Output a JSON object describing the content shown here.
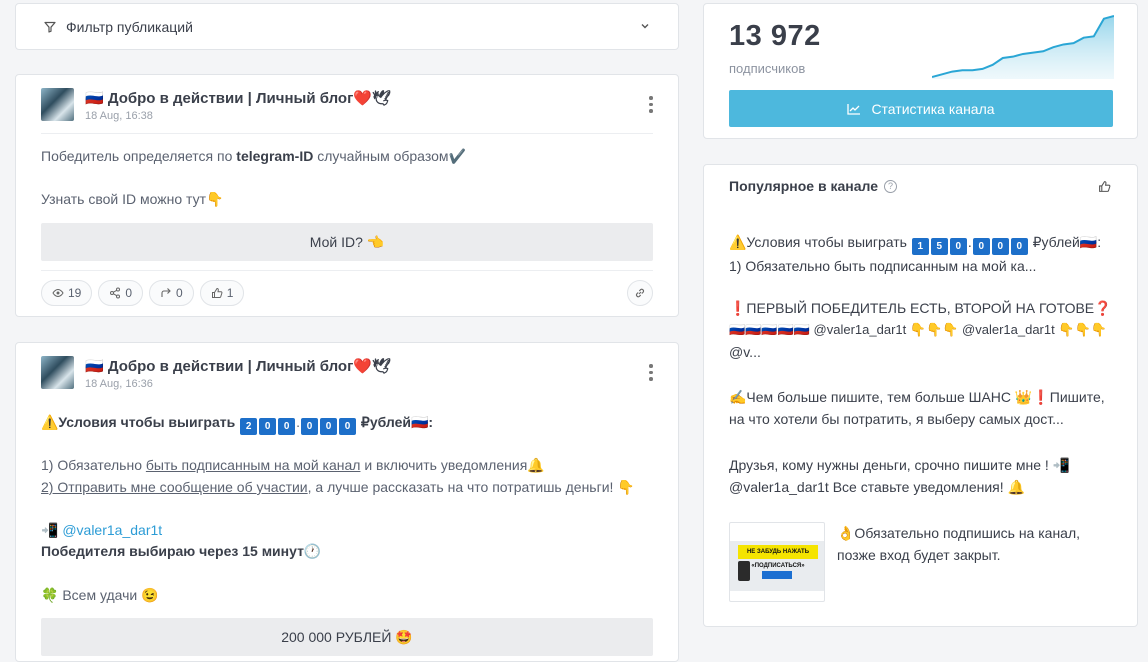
{
  "filter": {
    "label": "Фильтр публикаций"
  },
  "posts": [
    {
      "channel": "🇷🇺 Добро в действии | Личный блог❤️🕊",
      "date": "18 Aug, 16:38",
      "text1_pre": "Победитель определяется по ",
      "text1_bold": "telegram-ID",
      "text1_post": " случайным образом✔️",
      "text2": "Узнать свой ID можно тут👇",
      "button": "Мой ID? 👈",
      "stats": {
        "views": "19",
        "shares": "0",
        "forwards": "0",
        "likes": "1"
      }
    },
    {
      "channel": "🇷🇺 Добро в действии | Личный блог❤️🕊",
      "date": "18 Aug, 16:36",
      "headline": "⚠️Условия чтобы выиграть",
      "headline_digits": [
        "2",
        "0",
        "0",
        ".",
        "0",
        "0",
        "0"
      ],
      "headline_tail": "₽ублей🇷🇺:",
      "line1_pre": "1) Обязательно ",
      "line1_u": "быть подписанным на мой канал",
      "line1_post": " и включить уведомления🔔",
      "line2_u": "2) Отправить мне сообщение об участии",
      "line2_post": ", а лучше рассказать на что потратишь деньги! 👇",
      "contact_icon": "📲",
      "contact": "@valer1a_dar1t",
      "winner": "Победителя выбираю через 15 минут🕐",
      "luck": "🍀 Всем удачи 😉",
      "button": "200 000 РУБЛЕЙ 🤩"
    }
  ],
  "stats_card": {
    "subscribers": "13 972",
    "subscribers_label": "подписчиков",
    "button": "Статистика канала",
    "spark": [
      5,
      7,
      9,
      10,
      10,
      11,
      14,
      19,
      20,
      22,
      23,
      24,
      27,
      29,
      30,
      34,
      35,
      48,
      50
    ]
  },
  "popular": {
    "title": "Популярное в канале",
    "item1_pre": "⚠️Условия чтобы выиграть",
    "item1_digits": [
      "1",
      "5",
      "0",
      ".",
      "0",
      "0",
      "0"
    ],
    "item1_tail": "₽ублей🇷🇺:",
    "item1_line2": "1) Обязательно быть подписанным на мой ка...",
    "item2_line1": "❗️ПЕРВЫЙ ПОБЕДИТЕЛЬ ЕСТЬ, ВТОРОЙ НА ГОТОВЕ❓",
    "item2_line2": "🇷🇺🇷🇺🇷🇺🇷🇺🇷🇺 @valer1a_dar1t 👇👇👇 @valer1a_dar1t 👇👇👇",
    "item2_line3": "@v...",
    "item3_line1": "✍️Чем больше пишите, тем больше ШАНС 👑❗️Пишите,",
    "item3_line2": "на что хотели бы потратить, я выберу самых дост...",
    "item4_line1": "Друзья, кому нужны деньги, срочно пишите мне ! 📲",
    "item4_line2": "@valer1a_dar1t Все ставьте уведомления! 🔔",
    "item5_text": "👌Обязательно подпишись на канал, позже вход будет закрыт.",
    "thumb_caption": "НЕ ЗАБУДЬ НАЖАТЬ «ПОДПИСАТЬСЯ»"
  }
}
